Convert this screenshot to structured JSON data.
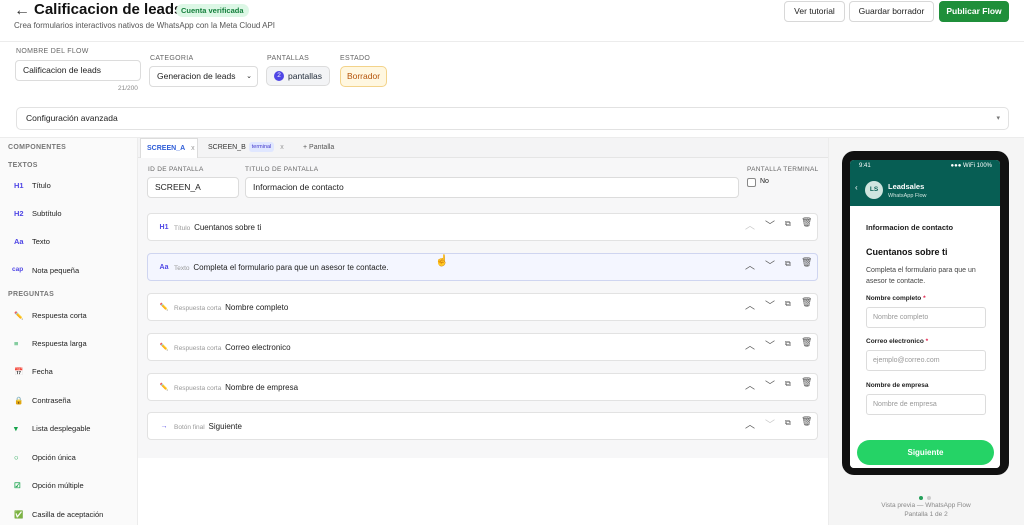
{
  "header": {
    "back_icon": "arrow-left",
    "title": "Calificacion de leads",
    "badge": "Cuenta verificada",
    "subtitle": "Crea formularios interactivos nativos de WhatsApp con la Meta Cloud API",
    "buttons": {
      "tutorial": "Ver tutorial",
      "save_draft": "Guardar borrador",
      "publish": "Publicar Flow"
    }
  },
  "meta": {
    "name_label": "NOMBRE DEL FLOW",
    "name_value": "Calificacion de leads",
    "name_counter": "21/200",
    "category_label": "CATEGORIA",
    "category_value": "Generacion de leads",
    "screens_label": "PANTALLAS",
    "screens_count": "2",
    "screens_text": "pantallas",
    "status_label": "ESTADO",
    "status_value": "Borrador"
  },
  "advanced": {
    "label": "Configuración avanzada",
    "chevron_icon": "chevron-down"
  },
  "sidebar": {
    "heading": "COMPONENTES",
    "sections": [
      {
        "title": "TEXTOS",
        "items": [
          {
            "icon": "H1",
            "label": "Título"
          },
          {
            "icon": "H2",
            "label": "Subtítulo"
          },
          {
            "icon": "Aa",
            "label": "Texto"
          },
          {
            "icon": "cap",
            "label": "Nota pequeña"
          }
        ]
      },
      {
        "title": "PREGUNTAS",
        "items": [
          {
            "icon": "✏️",
            "label": "Respuesta corta"
          },
          {
            "icon": "≡",
            "label": "Respuesta larga"
          },
          {
            "icon": "📅",
            "label": "Fecha"
          },
          {
            "icon": "🔒",
            "label": "Contraseña"
          },
          {
            "icon": "▾",
            "label": "Lista desplegable"
          },
          {
            "icon": "○",
            "label": "Opción única"
          },
          {
            "icon": "☑",
            "label": "Opción múltiple"
          },
          {
            "icon": "✅",
            "label": "Casilla de aceptación"
          }
        ]
      }
    ]
  },
  "tabs": {
    "screen_a": "SCREEN_A",
    "screen_b": "SCREEN_B",
    "terminal_tag": "terminal",
    "close_glyph": "x",
    "add_screen": "+ Pantalla"
  },
  "screen_form": {
    "id_label": "ID DE PANTALLA",
    "id_value": "SCREEN_A",
    "title_label": "TITULO DE PANTALLA",
    "title_value": "Informacion de contacto",
    "terminal_label": "PANTALLA TERMINAL",
    "terminal_value": "No"
  },
  "blocks": [
    {
      "icon": "H1",
      "type": "Título",
      "text": "Cuentanos sobre ti",
      "up_enabled": false,
      "down_enabled": true
    },
    {
      "icon": "Aa",
      "type": "Texto",
      "text": "Completa el formulario para que un asesor te contacte.",
      "up_enabled": true,
      "down_enabled": true
    },
    {
      "icon": "✏️",
      "type": "Respuesta corta",
      "text": "Nombre completo",
      "up_enabled": true,
      "down_enabled": true
    },
    {
      "icon": "✏️",
      "type": "Respuesta corta",
      "text": "Correo electronico",
      "up_enabled": true,
      "down_enabled": true
    },
    {
      "icon": "✏️",
      "type": "Respuesta corta",
      "text": "Nombre de empresa",
      "up_enabled": true,
      "down_enabled": true
    },
    {
      "icon": "→",
      "type": "Botón final",
      "text": "Siguiente",
      "up_enabled": true,
      "down_enabled": false
    }
  ],
  "phone": {
    "time": "9:41",
    "status_right": "●●● WiFi 100%",
    "contact_initials": "LS",
    "contact_name": "Leadsales",
    "contact_sub": "WhatsApp Flow",
    "screen_title": "Informacion de contacto",
    "heading": "Cuentanos sobre ti",
    "body": "Completa el formulario para que un asesor te contacte.",
    "fields": [
      {
        "label": "Nombre completo",
        "required": true,
        "placeholder": "Nombre completo"
      },
      {
        "label": "Correo electronico",
        "required": true,
        "placeholder": "ejemplo@correo.com"
      },
      {
        "label": "Nombre de empresa",
        "required": false,
        "placeholder": "Nombre de empresa"
      }
    ],
    "button": "Siguiente",
    "preview_label": "Vista previa — WhatsApp Flow",
    "page_label": "Pantalla 1 de 2",
    "colors": {
      "wa_header": "#075e54",
      "wa_button": "#25d366",
      "accent": "#4f46e5",
      "publish": "#1f8f3a"
    }
  }
}
